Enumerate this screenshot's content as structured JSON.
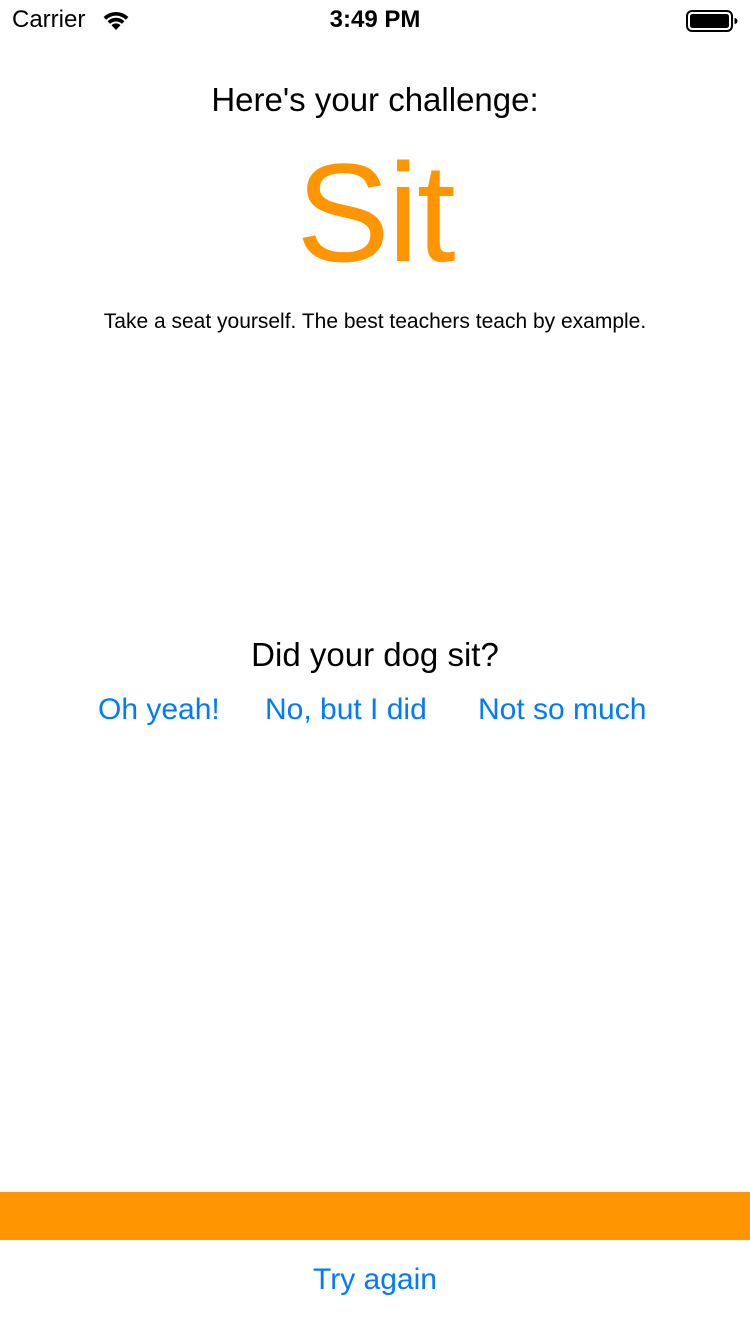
{
  "status_bar": {
    "carrier": "Carrier",
    "time": "3:49 PM",
    "wifi_icon": "wifi-icon",
    "battery_icon": "battery-full-icon"
  },
  "challenge": {
    "heading": "Here's your challenge:",
    "command": "Sit",
    "tip": "Take a seat yourself. The best teachers teach by example."
  },
  "question": {
    "prompt": "Did your dog sit?",
    "answers": [
      "Oh yeah!",
      "No, but I did",
      "Not so much"
    ]
  },
  "footer": {
    "try_again_label": "Try again"
  },
  "colors": {
    "accent": "#FF9500",
    "link": "#007AFF",
    "text": "#000000",
    "background": "#FFFFFF"
  }
}
